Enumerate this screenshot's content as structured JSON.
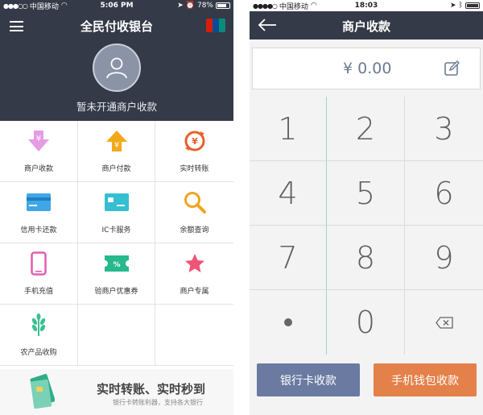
{
  "left": {
    "status": {
      "carrier": "中国移动",
      "time": "5:06 PM",
      "battery": "78%"
    },
    "title": "全民付收银台",
    "unionpay_text": "UnionPay",
    "account_note": "暂未开通商户收款",
    "grid": [
      {
        "label": "商户收款",
        "icon": "download-yen-icon"
      },
      {
        "label": "商户付款",
        "icon": "upload-yen-icon"
      },
      {
        "label": "实时转账",
        "icon": "transfer-yen-icon"
      },
      {
        "label": "信用卡还款",
        "icon": "credit-card-icon"
      },
      {
        "label": "IC卡服务",
        "icon": "ic-card-icon"
      },
      {
        "label": "余额查询",
        "icon": "magnifier-icon"
      },
      {
        "label": "手机充值",
        "icon": "phone-icon"
      },
      {
        "label": "验商户优惠券",
        "icon": "coupon-icon"
      },
      {
        "label": "商户专属",
        "icon": "star-icon"
      },
      {
        "label": "农产品收购",
        "icon": "wheat-icon"
      }
    ],
    "banner": {
      "title": "实时转账、实时秒到",
      "subtitle": "银行卡转账利器，支持各大银行"
    }
  },
  "right": {
    "status": {
      "carrier": "中国移动",
      "time": "18:03"
    },
    "title": "商户收款",
    "amount": "¥ 0.00",
    "keys": [
      "1",
      "2",
      "3",
      "4",
      "5",
      "6",
      "7",
      "8",
      "9",
      "0"
    ],
    "buttons": {
      "card": "银行卡收款",
      "wallet": "手机钱包收款"
    }
  },
  "colors": {
    "header": "#343a47",
    "accent_blue": "#6a7aa0",
    "accent_orange": "#e4804a"
  }
}
